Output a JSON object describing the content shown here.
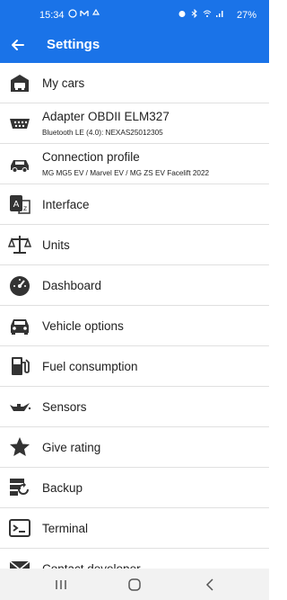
{
  "status_bar": {
    "time": "15:34",
    "battery": "27%",
    "left_icons": [
      "whatsapp-icon",
      "gmail-icon",
      "recycle-icon"
    ],
    "right_icons": [
      "alarm-icon",
      "bluetooth-icon",
      "wifi-icon",
      "signal-icon"
    ]
  },
  "app_bar": {
    "title": "Settings",
    "back_icon": "arrow-back-icon"
  },
  "menu": [
    {
      "label": "My cars",
      "icon": "garage-car-icon"
    },
    {
      "label": "Adapter OBDII ELM327",
      "sub": "Bluetooth LE (4.0): NEXAS25012305",
      "icon": "obd-connector-icon"
    },
    {
      "label": "Connection profile",
      "sub": "MG MG5 EV / Marvel EV / MG ZS EV Facelift 2022",
      "icon": "car-icon"
    },
    {
      "label": "Interface",
      "icon": "translate-icon"
    },
    {
      "label": "Units",
      "icon": "scale-icon"
    },
    {
      "label": "Dashboard",
      "icon": "speedometer-icon"
    },
    {
      "label": "Vehicle options",
      "icon": "car-front-icon"
    },
    {
      "label": "Fuel consumption",
      "icon": "fuel-pump-icon"
    },
    {
      "label": "Sensors",
      "icon": "oil-can-icon"
    },
    {
      "label": "Give rating",
      "icon": "star-icon"
    },
    {
      "label": "Backup",
      "icon": "backup-restore-icon"
    },
    {
      "label": "Terminal",
      "icon": "terminal-icon"
    },
    {
      "label": "Contact developer",
      "icon": "envelope-icon"
    }
  ],
  "nav_bar": {
    "buttons": [
      "recents-icon",
      "home-icon",
      "back-icon"
    ]
  },
  "colors": {
    "primary": "#1a73e8",
    "icon": "#333333",
    "divider": "#e0e0e0"
  }
}
